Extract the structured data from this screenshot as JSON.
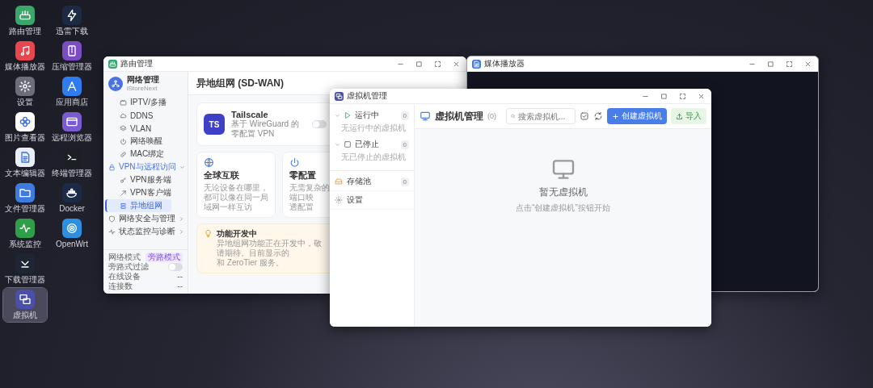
{
  "desktop_icons": [
    {
      "label": "路由管理",
      "color": "#3aa66a",
      "selected": false
    },
    {
      "label": "媒体播放器",
      "color": "#e8464f",
      "selected": false
    },
    {
      "label": "设置",
      "color": "#6b6e78",
      "selected": false
    },
    {
      "label": "图片查看器",
      "color": "#ffffff",
      "selected": false
    },
    {
      "label": "文本编辑器",
      "color": "#e9eef7",
      "selected": false
    },
    {
      "label": "文件管理器",
      "color": "#3d7be0",
      "selected": false
    },
    {
      "label": "系统监控",
      "color": "#2f9e48",
      "selected": false
    },
    {
      "label": "下载管理器",
      "color": "#1e2633",
      "selected": false
    },
    {
      "label": "虚拟机",
      "color": "#4a4fa8",
      "selected": true
    },
    {
      "label": "迅雷下载",
      "color": "#1d2a44",
      "selected": false
    },
    {
      "label": "压缩管理器",
      "color": "#7b4cc2",
      "selected": false
    },
    {
      "label": "应用商店",
      "color": "#2f7cf0",
      "selected": false
    },
    {
      "label": "远程浏览器",
      "color": "#7a5bd0",
      "selected": false
    },
    {
      "label": "终端管理器",
      "color": "#1c1f24",
      "selected": false
    },
    {
      "label": "Docker",
      "color": "#1a2a48",
      "selected": false
    },
    {
      "label": "OpenWrt",
      "color": "#2d8fe0",
      "selected": false
    }
  ],
  "router_window": {
    "title": "路由管理",
    "sidebar": {
      "brand": "网络管理",
      "subtitle": "iStoreNext",
      "nav_tail_items": [
        {
          "label": "IPTV/多播",
          "selected": false
        },
        {
          "label": "DDNS",
          "selected": false
        },
        {
          "label": "VLAN",
          "selected": false
        },
        {
          "label": "网络唤醒",
          "selected": false
        },
        {
          "label": "MAC绑定",
          "selected": false
        }
      ],
      "groups": [
        {
          "label": "VPN与远程访问",
          "expanded": true,
          "children": [
            {
              "label": "VPN服务端",
              "selected": false
            },
            {
              "label": "VPN客户端",
              "selected": false
            },
            {
              "label": "异地组网",
              "selected": true
            }
          ]
        },
        {
          "label": "网络安全与管理",
          "expanded": false
        },
        {
          "label": "状态监控与诊断",
          "expanded": false
        }
      ],
      "status": [
        {
          "kind": "tag",
          "label": "网络模式",
          "value": "旁路模式"
        },
        {
          "kind": "toggle",
          "label": "旁路式过滤",
          "on": false
        },
        {
          "kind": "text",
          "label": "在线设备",
          "value": "--"
        },
        {
          "kind": "text",
          "label": "连接数",
          "value": "--"
        }
      ]
    },
    "main": {
      "title": "异地组网 (SD-WAN)",
      "service": {
        "badge": "TS",
        "name": "Tailscale",
        "description": "基于 WireGuard 的零配置 VPN",
        "enabled": false
      },
      "features": [
        {
          "title": "全球互联",
          "lines": [
            "无论设备在哪里，都可以像在同一局域网一样互访"
          ]
        },
        {
          "title": "零配置",
          "lines": [
            "无需复杂的端口映",
            "透配置"
          ]
        }
      ],
      "notice": {
        "title": "功能开发中",
        "lines": [
          "异地组网功能正在开发中，敬请期待。目前显示的",
          "和 ZeroTier 服务。"
        ]
      }
    }
  },
  "media_player_window": {
    "title": "媒体播放器"
  },
  "vm_window": {
    "title": "虚拟机管理",
    "sidebar": {
      "sections": [
        {
          "label": "运行中",
          "count": "0",
          "expanded": true,
          "empty_text": "无运行中的虚拟机"
        },
        {
          "label": "已停止",
          "count": "0",
          "expanded": true,
          "empty_text": "无已停止的虚拟机"
        }
      ],
      "links": [
        {
          "label": "存储池",
          "count": "0"
        },
        {
          "label": "设置"
        }
      ]
    },
    "main": {
      "title": "虚拟机管理",
      "count": "(0)",
      "search": {
        "placeholder": "搜索虚拟机..."
      },
      "create_button": "创建虚拟机",
      "import_button": "导入",
      "empty_title": "暂无虚拟机",
      "empty_hint": "点击“创建虚拟机”按钮开始"
    }
  }
}
